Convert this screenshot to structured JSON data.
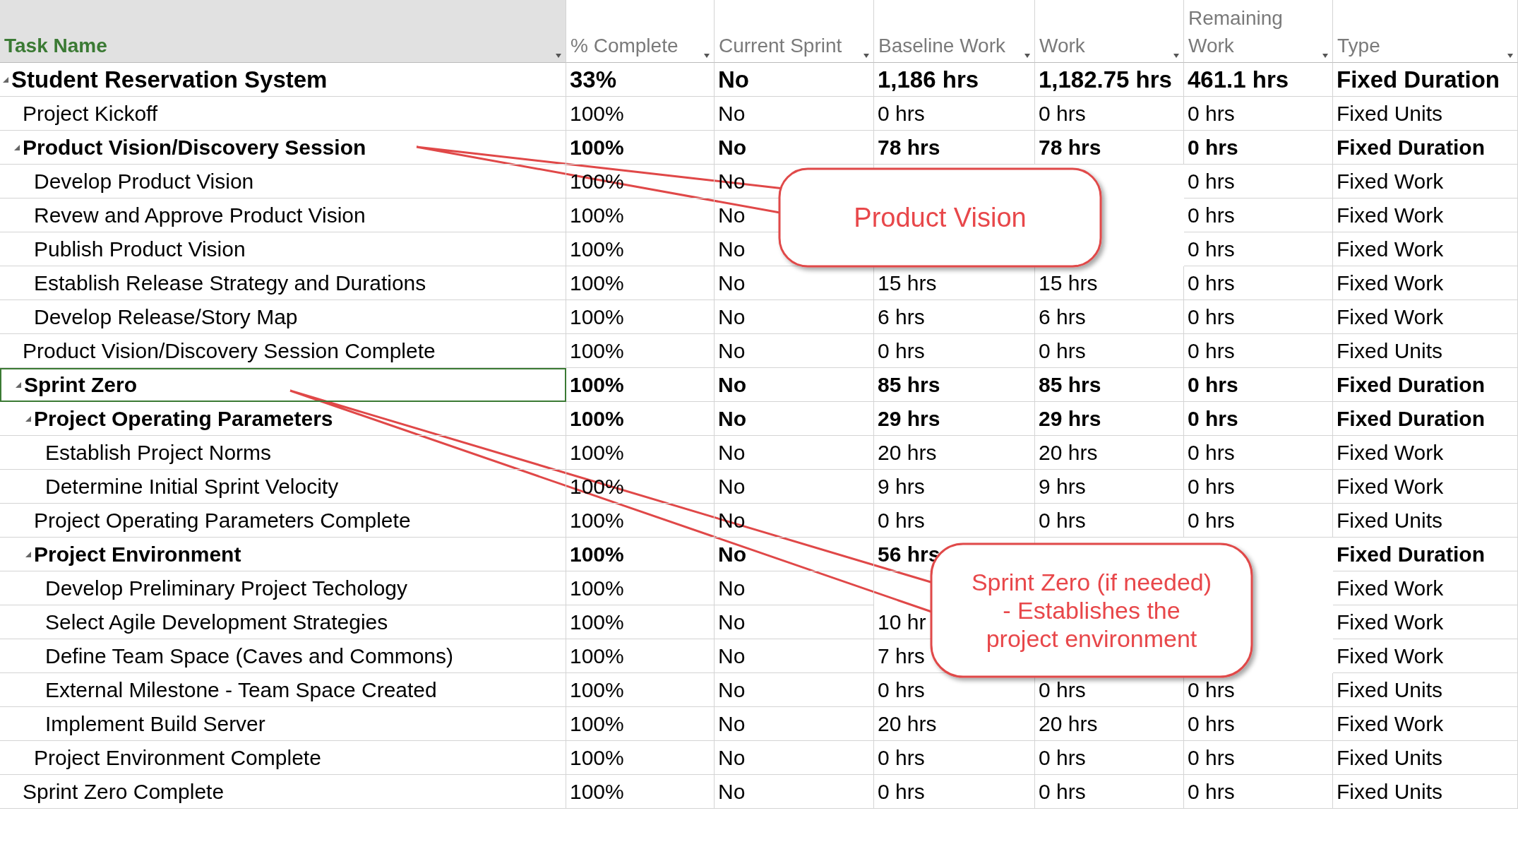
{
  "table": {
    "columns": [
      {
        "label": "Task Name"
      },
      {
        "label": "% Complete"
      },
      {
        "label": "Current Sprint"
      },
      {
        "label": "Baseline Work"
      },
      {
        "label": "Work"
      },
      {
        "label": "Remaining Work"
      },
      {
        "label": "Type"
      }
    ],
    "rows": [
      {
        "name": "Student Reservation System",
        "expanded": true,
        "selected": false,
        "values": {
          "complete": "33%",
          "sprint": "No",
          "baseline": "1,186 hrs",
          "work": "1,182.75 hrs",
          "remaining": "461.1 hrs",
          "type": "Fixed Duration"
        },
        "children": [
          {
            "name": "Project Kickoff",
            "selected": false,
            "values": {
              "complete": "100%",
              "sprint": "No",
              "baseline": "0 hrs",
              "work": "0 hrs",
              "remaining": "0 hrs",
              "type": "Fixed Units"
            }
          },
          {
            "name": "Product Vision/Discovery Session",
            "expanded": true,
            "selected": false,
            "values": {
              "complete": "100%",
              "sprint": "No",
              "baseline": "78 hrs",
              "work": "78 hrs",
              "remaining": "0 hrs",
              "type": "Fixed Duration"
            },
            "children": [
              {
                "name": "Develop Product Vision",
                "selected": false,
                "values": {
                  "complete": "100%",
                  "sprint": "No",
                  "remaining": "0 hrs",
                  "type": "Fixed Work"
                }
              },
              {
                "name": "Revew and Approve Product Vision",
                "selected": false,
                "values": {
                  "complete": "100%",
                  "sprint": "No",
                  "remaining": "0 hrs",
                  "type": "Fixed Work"
                }
              },
              {
                "name": "Publish Product Vision",
                "selected": false,
                "values": {
                  "complete": "100%",
                  "sprint": "No",
                  "remaining": "0 hrs",
                  "type": "Fixed Work"
                }
              },
              {
                "name": "Establish Release Strategy and Durations",
                "selected": false,
                "values": {
                  "complete": "100%",
                  "sprint": "No",
                  "baseline": "15 hrs",
                  "work": "15 hrs",
                  "remaining": "0 hrs",
                  "type": "Fixed Work"
                }
              },
              {
                "name": "Develop Release/Story Map",
                "selected": false,
                "values": {
                  "complete": "100%",
                  "sprint": "No",
                  "baseline": "6 hrs",
                  "work": "6 hrs",
                  "remaining": "0 hrs",
                  "type": "Fixed Work"
                }
              }
            ]
          },
          {
            "name": "Product Vision/Discovery Session Complete",
            "selected": false,
            "values": {
              "complete": "100%",
              "sprint": "No",
              "baseline": "0 hrs",
              "work": "0 hrs",
              "remaining": "0 hrs",
              "type": "Fixed Units"
            }
          },
          {
            "name": "Sprint Zero",
            "expanded": true,
            "selected": true,
            "values": {
              "complete": "100%",
              "sprint": "No",
              "baseline": "85 hrs",
              "work": "85 hrs",
              "remaining": "0 hrs",
              "type": "Fixed Duration"
            },
            "children": [
              {
                "name": "Project Operating Parameters",
                "expanded": true,
                "selected": false,
                "values": {
                  "complete": "100%",
                  "sprint": "No",
                  "baseline": "29 hrs",
                  "work": "29 hrs",
                  "remaining": "0 hrs",
                  "type": "Fixed Duration"
                },
                "children": [
                  {
                    "name": "Establish Project Norms",
                    "selected": false,
                    "values": {
                      "complete": "100%",
                      "sprint": "No",
                      "baseline": "20 hrs",
                      "work": "20 hrs",
                      "remaining": "0 hrs",
                      "type": "Fixed Work"
                    }
                  },
                  {
                    "name": "Determine Initial Sprint Velocity",
                    "selected": false,
                    "values": {
                      "complete": "100%",
                      "sprint": "No",
                      "baseline": "9 hrs",
                      "work": "9 hrs",
                      "remaining": "0 hrs",
                      "type": "Fixed Work"
                    }
                  }
                ]
              },
              {
                "name": "Project Operating Parameters Complete",
                "selected": false,
                "values": {
                  "complete": "100%",
                  "sprint": "No",
                  "baseline": "0 hrs",
                  "work": "0 hrs",
                  "remaining": "0 hrs",
                  "type": "Fixed Units"
                }
              },
              {
                "name": "Project Environment",
                "expanded": true,
                "selected": false,
                "values": {
                  "complete": "100%",
                  "sprint": "No",
                  "baseline": "56 hrs",
                  "type": "Fixed Duration"
                },
                "children": [
                  {
                    "name": "Develop Preliminary Project Techology",
                    "selected": false,
                    "values": {
                      "complete": "100%",
                      "sprint": "No",
                      "type": "Fixed Work"
                    }
                  },
                  {
                    "name": "Select Agile Development Strategies",
                    "selected": false,
                    "values": {
                      "complete": "100%",
                      "sprint": "No",
                      "baseline": "10 hr",
                      "type": "Fixed Work"
                    }
                  },
                  {
                    "name": "Define Team Space (Caves and Commons)",
                    "selected": false,
                    "values": {
                      "complete": "100%",
                      "sprint": "No",
                      "baseline": "7 hrs",
                      "type": "Fixed Work"
                    }
                  },
                  {
                    "name": "External Milestone - Team Space Created",
                    "selected": false,
                    "values": {
                      "complete": "100%",
                      "sprint": "No",
                      "baseline": "0 hrs",
                      "work": "0 hrs",
                      "remaining": "0 hrs",
                      "type": "Fixed Units"
                    }
                  },
                  {
                    "name": "Implement Build Server",
                    "selected": false,
                    "values": {
                      "complete": "100%",
                      "sprint": "No",
                      "baseline": "20 hrs",
                      "work": "20 hrs",
                      "remaining": "0 hrs",
                      "type": "Fixed Work"
                    }
                  }
                ]
              },
              {
                "name": "Project Environment Complete",
                "selected": false,
                "values": {
                  "complete": "100%",
                  "sprint": "No",
                  "baseline": "0 hrs",
                  "work": "0 hrs",
                  "remaining": "0 hrs",
                  "type": "Fixed Units"
                }
              }
            ]
          },
          {
            "name": "Sprint Zero Complete",
            "selected": false,
            "values": {
              "complete": "100%",
              "sprint": "No",
              "baseline": "0 hrs",
              "work": "0 hrs",
              "remaining": "0 hrs",
              "type": "Fixed Units"
            }
          }
        ]
      }
    ]
  },
  "callouts": [
    {
      "text": "Product Vision"
    },
    {
      "text": "Sprint Zero (if needed) - Establishes the project environment"
    }
  ]
}
